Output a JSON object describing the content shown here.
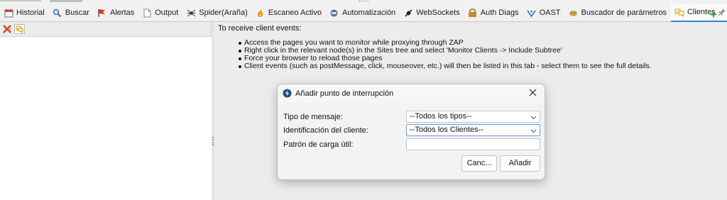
{
  "tabs": [
    {
      "name": "tab-historial",
      "label": "Historial",
      "icon": "calendar-icon"
    },
    {
      "name": "tab-buscar",
      "label": "Buscar",
      "icon": "magnifier-icon"
    },
    {
      "name": "tab-alertas",
      "label": "Alertas",
      "icon": "flag-icon"
    },
    {
      "name": "tab-output",
      "label": "Output",
      "icon": "document-icon"
    },
    {
      "name": "tab-spider",
      "label": "Spider(Araña)",
      "icon": "spider-icon"
    },
    {
      "name": "tab-escaneo-activo",
      "label": "Escaneo Activo",
      "icon": "flame-icon"
    },
    {
      "name": "tab-automatizacion",
      "label": "Automatización",
      "icon": "robot-icon"
    },
    {
      "name": "tab-websockets",
      "label": "WebSockets",
      "icon": "plug-icon"
    },
    {
      "name": "tab-auth-diags",
      "label": "Auth Diags",
      "icon": "auth-icon"
    },
    {
      "name": "tab-oast",
      "label": "OAST",
      "icon": "oast-icon"
    },
    {
      "name": "tab-buscador-parametros",
      "label": "Buscador de parámetros",
      "icon": "cookie-icon"
    },
    {
      "name": "tab-clientes",
      "label": "Clientes",
      "icon": "clients-icon",
      "active": true
    }
  ],
  "content": {
    "instructions_title": "To receive client events:",
    "steps": [
      "Access the pages you want to monitor while proxying through ZAP",
      "Right click in the relevant node(s) in the Sites tree and select 'Monitor Clients -> Include Subtree'",
      "Force your browser to reload those pages",
      "Client events (such as postMessage, click, mouseover, etc.) will then be listed in this tab - select them to see the full details."
    ]
  },
  "dialog": {
    "title": "Añadir punto de interrupción",
    "message_type_label": "Tipo de mensaje:",
    "message_type_value": "--Todos los tipos--",
    "client_id_label": "Identificación del cliente:",
    "client_id_value": "--Todos los Clientes--",
    "payload_label": "Patrón de carga útil:",
    "payload_value": "",
    "cancel_label": "Canc...",
    "add_label": "Añadir"
  },
  "colors": {
    "accent": "#3c7fd8",
    "add_green": "#2aa52a",
    "clear_red": "#d9412b"
  }
}
